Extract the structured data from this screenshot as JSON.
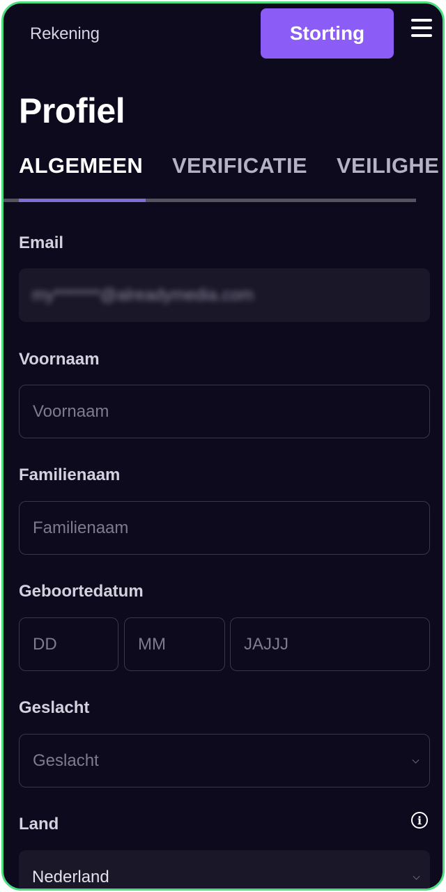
{
  "header": {
    "account_label": "Rekening",
    "deposit_label": "Storting"
  },
  "page": {
    "title": "Profiel"
  },
  "tabs": [
    {
      "label": "ALGEMEEN",
      "active": true
    },
    {
      "label": "VERIFICATIE",
      "active": false
    },
    {
      "label": "VEILIGHE",
      "active": false
    }
  ],
  "form": {
    "email": {
      "label": "Email",
      "value": "my*******@alreadymedia.com"
    },
    "first_name": {
      "label": "Voornaam",
      "placeholder": "Voornaam"
    },
    "last_name": {
      "label": "Familienaam",
      "placeholder": "Familienaam"
    },
    "birth_date": {
      "label": "Geboortedatum",
      "day_placeholder": "DD",
      "month_placeholder": "MM",
      "year_placeholder": "JAJJJ"
    },
    "gender": {
      "label": "Geslacht",
      "placeholder": "Geslacht"
    },
    "country": {
      "label": "Land",
      "value": "Nederland"
    }
  },
  "icons": {
    "menu": "hamburger-menu-icon",
    "info": "info-icon",
    "dropdown": "chevron-down-icon"
  },
  "colors": {
    "background": "#0d0a1e",
    "accent": "#8b5cf6",
    "frame_border": "#4ade80",
    "tab_indicator": "#7c6fd9"
  }
}
